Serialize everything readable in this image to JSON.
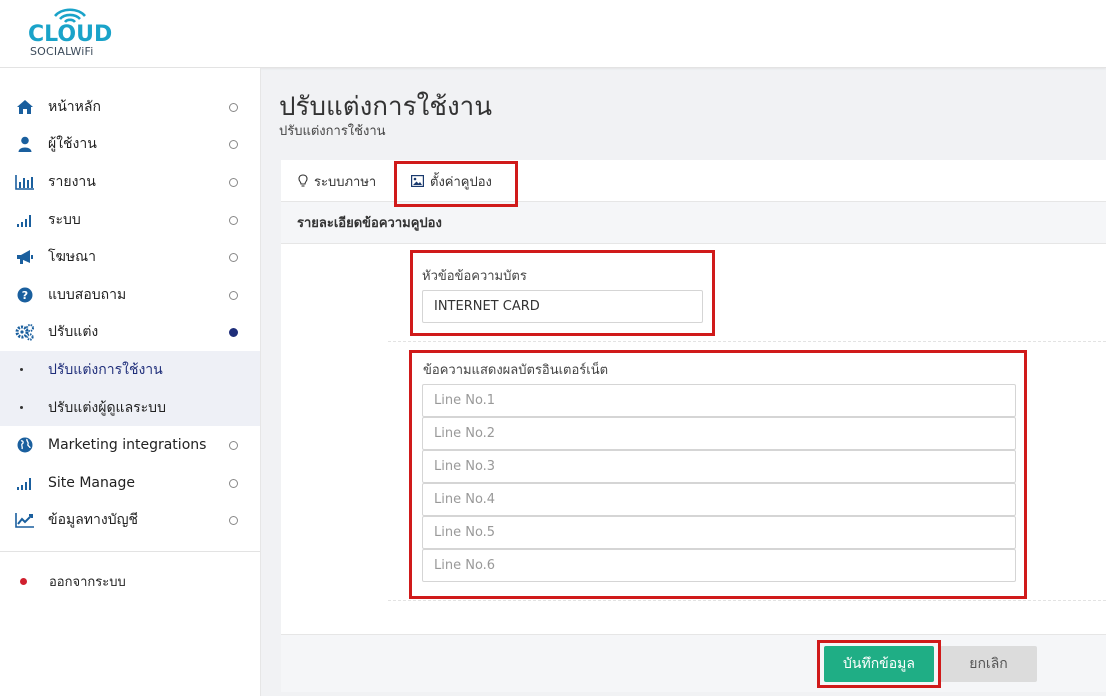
{
  "brand": {
    "name": "CLOUD",
    "tagline": "SOCIALWiFi",
    "color": "#1aa3c9"
  },
  "sidebar": {
    "items": [
      {
        "label": "หน้าหลัก",
        "icon": "home-icon"
      },
      {
        "label": "ผู้ใช้งาน",
        "icon": "user-icon"
      },
      {
        "label": "รายงาน",
        "icon": "bar-chart-icon"
      },
      {
        "label": "ระบบ",
        "icon": "signal-icon"
      },
      {
        "label": "โฆษณา",
        "icon": "megaphone-icon"
      },
      {
        "label": "แบบสอบถาม",
        "icon": "question-icon"
      },
      {
        "label": "ปรับแต่ง",
        "icon": "gears-icon"
      }
    ],
    "sub_items": [
      {
        "label": "ปรับแต่งการใช้งาน"
      },
      {
        "label": "ปรับแต่งผู้ดูแลระบบ"
      }
    ],
    "items_after": [
      {
        "label": "Marketing integrations",
        "icon": "globe-icon"
      },
      {
        "label": "Site Manage",
        "icon": "signal-icon"
      },
      {
        "label": "ข้อมูลทางบัญชี",
        "icon": "line-chart-icon"
      }
    ],
    "logout_label": "ออกจากระบบ"
  },
  "page": {
    "title": "ปรับแต่งการใช้งาน",
    "subtitle": "ปรับแต่งการใช้งาน"
  },
  "tabs": [
    {
      "label": "ระบบภาษา",
      "icon": "lightbulb-icon"
    },
    {
      "label": "ตั้งค่าคูปอง",
      "icon": "image-icon"
    }
  ],
  "panel": {
    "heading": "รายละเอียดข้อความคูปอง",
    "card_title_label": "หัวข้อข้อความบัตร",
    "card_title_value": "INTERNET CARD",
    "message_label": "ข้อความแสดงผลบัตรอินเตอร์เน็ต",
    "lines": [
      "Line No.1",
      "Line No.2",
      "Line No.3",
      "Line No.4",
      "Line No.5",
      "Line No.6"
    ]
  },
  "actions": {
    "save_label": "บันทึกข้อมูล",
    "cancel_label": "ยกเลิก"
  },
  "colors": {
    "nav_icon": "#1a5f9e",
    "active_dot": "#1f2e7a",
    "save_button": "#1fae85",
    "highlight_box": "#d01a1a"
  }
}
